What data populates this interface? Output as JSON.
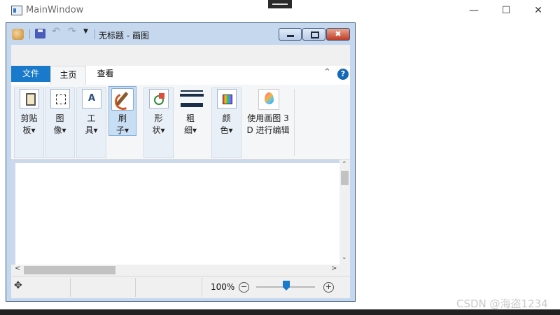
{
  "outer": {
    "title": "MainWindow",
    "controls": {
      "min": "—",
      "max": "☐",
      "close": "✕"
    }
  },
  "paint": {
    "title": "无标题 - 画图",
    "quick_access": {
      "undo": "↶",
      "redo": "↷",
      "dropdown": "▼"
    },
    "window_controls": {
      "min": "",
      "max": "",
      "close": "✖"
    },
    "tabs": {
      "file": "文件",
      "home": "主页",
      "view": "查看"
    },
    "ribbon_ctrls": {
      "collapse": "⌃",
      "help": "?"
    },
    "ribbon": {
      "clipboard": "剪贴\n板▾",
      "image": "图\n像▾",
      "tools": "工\n具▾",
      "tools_glyph": "A",
      "brushes": "刷\n子▾",
      "shapes": "形\n状▾",
      "size": "粗\n细▾",
      "colors": "颜\n色▾",
      "paint3d": "使用画图 3\nD 进行编辑"
    },
    "scroll": {
      "up": "⌃",
      "down": "⌄",
      "left": "<",
      "right": ">"
    },
    "status": {
      "move": "✥",
      "zoom": "100%",
      "zoom_out": "−",
      "zoom_in": "+",
      "zoom_level": 0.5
    }
  },
  "watermark": "CSDN @海盗1234"
}
